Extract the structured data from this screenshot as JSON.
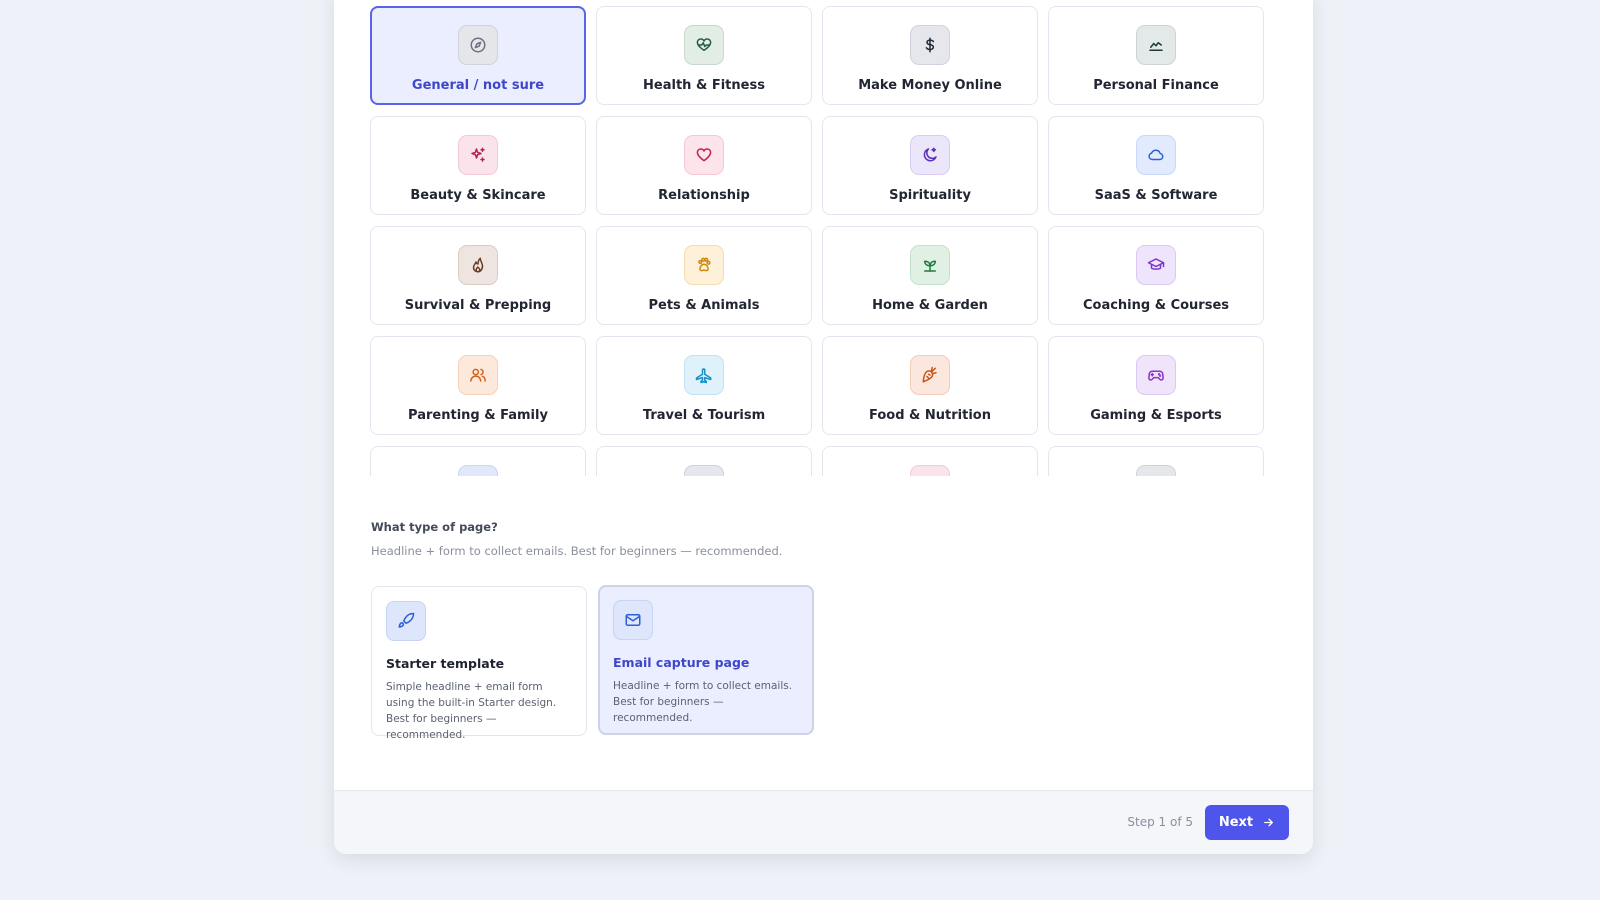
{
  "niches": [
    {
      "label": "General / not sure",
      "icon": "compass-icon",
      "bg": "#e4e6ea",
      "border": "#cfd3da",
      "color": "#6b7280",
      "selected": true
    },
    {
      "label": "Health & Fitness",
      "icon": "heart-pulse-icon",
      "bg": "#e2ede6",
      "border": "#c8d8cd",
      "color": "#1f5c3d",
      "selected": false
    },
    {
      "label": "Make Money Online",
      "icon": "dollar-icon",
      "bg": "#e5e7ec",
      "border": "#cfd3dc",
      "color": "#1f2937",
      "selected": false
    },
    {
      "label": "Personal Finance",
      "icon": "trend-line-icon",
      "bg": "#e3e8e8",
      "border": "#ccd4d4",
      "color": "#1f3a3a",
      "selected": false
    },
    {
      "label": "Beauty & Skincare",
      "icon": "sparkles-icon",
      "bg": "#fbe3ec",
      "border": "#f3c9d8",
      "color": "#b0245a",
      "selected": false
    },
    {
      "label": "Relationship",
      "icon": "heart-icon",
      "bg": "#fde4ea",
      "border": "#f6c8d3",
      "color": "#be1f47",
      "selected": false
    },
    {
      "label": "Spirituality",
      "icon": "moon-star-icon",
      "bg": "#ece6fb",
      "border": "#d8ccf4",
      "color": "#5b31b8",
      "selected": false
    },
    {
      "label": "SaaS & Software",
      "icon": "cloud-icon",
      "bg": "#e1ebfd",
      "border": "#c8d8f7",
      "color": "#2d5fd6",
      "selected": false
    },
    {
      "label": "Survival & Prepping",
      "icon": "flame-icon",
      "bg": "#efe5e0",
      "border": "#dccbc2",
      "color": "#6b3a24",
      "selected": false
    },
    {
      "label": "Pets & Animals",
      "icon": "paw-icon",
      "bg": "#fdf1d9",
      "border": "#f4ddb0",
      "color": "#c98a0a",
      "selected": false
    },
    {
      "label": "Home & Garden",
      "icon": "sprout-icon",
      "bg": "#e0f1e4",
      "border": "#c4e2cb",
      "color": "#1d7a3c",
      "selected": false
    },
    {
      "label": "Coaching & Courses",
      "icon": "graduation-cap-icon",
      "bg": "#eee4fb",
      "border": "#dbc9f4",
      "color": "#7a33c9",
      "selected": false
    },
    {
      "label": "Parenting & Family",
      "icon": "users-icon",
      "bg": "#fde9dc",
      "border": "#f5d1b8",
      "color": "#d4621a",
      "selected": false
    },
    {
      "label": "Travel & Tourism",
      "icon": "plane-icon",
      "bg": "#dff1fb",
      "border": "#c3e2f4",
      "color": "#1690c9",
      "selected": false
    },
    {
      "label": "Food & Nutrition",
      "icon": "carrot-icon",
      "bg": "#fbe7dd",
      "border": "#f2cdb9",
      "color": "#c4531a",
      "selected": false
    },
    {
      "label": "Gaming & Esports",
      "icon": "gamepad-icon",
      "bg": "#f0e4fb",
      "border": "#dcc8f4",
      "color": "#8a34c9",
      "selected": false
    },
    {
      "label": "",
      "icon": "diamond-icon",
      "bg": "#e1e8fb",
      "border": "#c9d5f4",
      "color": "#2f4fb8",
      "selected": false
    },
    {
      "label": "",
      "icon": "pen-tool-icon",
      "bg": "#e5e7ee",
      "border": "#cfd3de",
      "color": "#2a3350",
      "selected": false
    },
    {
      "label": "",
      "icon": "hanger-icon",
      "bg": "#fbe3ec",
      "border": "#f3c9d8",
      "color": "#b0245a",
      "selected": false
    },
    {
      "label": "",
      "icon": "car-icon",
      "bg": "#e6e7ea",
      "border": "#d0d2d8",
      "color": "#374151",
      "selected": false
    }
  ],
  "page_type": {
    "heading": "What type of page?",
    "subtitle": "Headline + form to collect emails. Best for beginners — recommended.",
    "options": [
      {
        "title": "Starter template",
        "description": "Simple headline + email form using the built-in Starter design. Best for beginners — recommended.",
        "icon": "rocket-icon",
        "selected": false
      },
      {
        "title": "Email capture page",
        "description": "Headline + form to collect emails. Best for beginners — recommended.",
        "icon": "mail-icon",
        "selected": true
      }
    ]
  },
  "footer": {
    "step_label": "Step 1 of 5",
    "next_label": "Next"
  },
  "colors": {
    "accent": "#4f55ea",
    "selected_bg": "#ebeefe",
    "selected_border": "#5b63e6",
    "page_bg": "#eef1f7"
  }
}
